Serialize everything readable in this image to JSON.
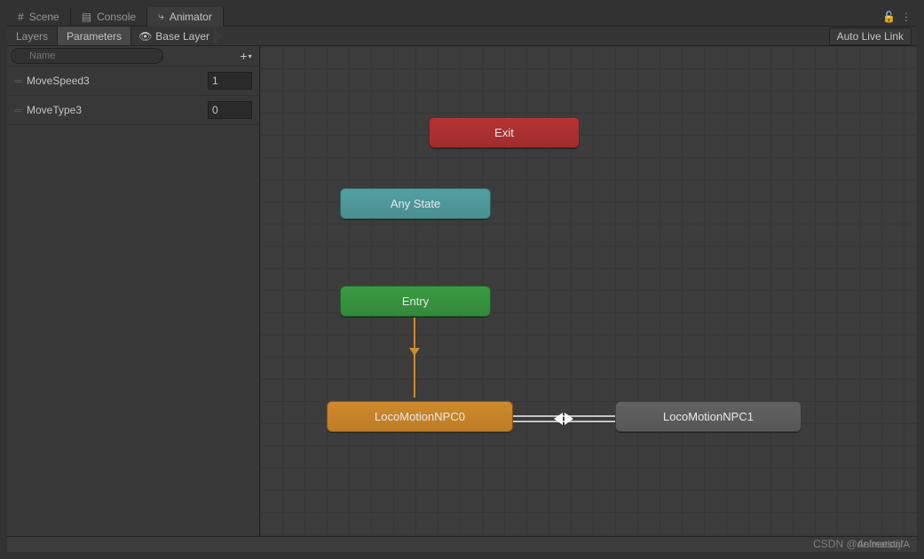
{
  "tabs": {
    "scene": "Scene",
    "console": "Console",
    "animator": "Animator"
  },
  "subTabs": {
    "layers": "Layers",
    "parameters": "Parameters",
    "baseLayer": "Base Layer",
    "autoLive": "Auto Live Link"
  },
  "search": {
    "placeholder": "Name",
    "value": ""
  },
  "params": [
    {
      "name": "MoveSpeed3",
      "value": "1"
    },
    {
      "name": "MoveType3",
      "value": "0"
    }
  ],
  "nodes": {
    "exit": "Exit",
    "anyState": "Any State",
    "entry": "Entry",
    "loco0": "LocoMotionNPC0",
    "loco1": "LocoMotionNPC1"
  },
  "footer": "Animation/A",
  "watermark": "CSDN @defreestijl"
}
